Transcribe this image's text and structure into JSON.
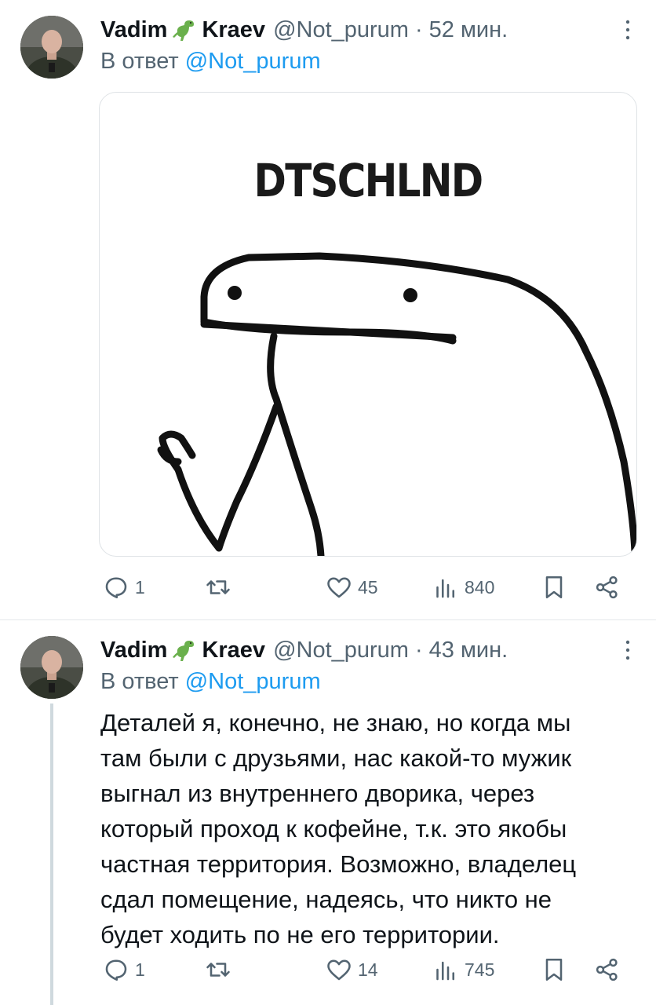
{
  "tweets": [
    {
      "author_name_first": "Vadim",
      "author_name_last": "Kraev",
      "handle": "@Not_purum",
      "separator": "·",
      "time": "52 мин.",
      "reply_prefix": "В ответ",
      "reply_to": "@Not_purum",
      "media_caption": "DTSCHLND",
      "stats": {
        "replies": "1",
        "retweets": "",
        "likes": "45",
        "views": "840"
      }
    },
    {
      "author_name_first": "Vadim",
      "author_name_last": "Kraev",
      "handle": "@Not_purum",
      "separator": "·",
      "time": "43 мин.",
      "reply_prefix": "В ответ",
      "reply_to": "@Not_purum",
      "text_lines": [
        "Деталей я, конечно, не знаю, но когда мы",
        "там были с друзьями, нас какой-то мужик",
        "выгнал из внутреннего дворика, через",
        "который проход к кофейне, т.к. это якобы",
        "частная территория. Возможно, владелец",
        "сдал помещение, надеясь, что никто не",
        "будет ходить по не его территории."
      ],
      "stats": {
        "replies": "1",
        "retweets": "",
        "likes": "14",
        "views": "745"
      }
    }
  ],
  "icons": {
    "name_badge": "dinosaur-emoji",
    "more": "vertical-dots-icon",
    "reply": "speech-bubble-icon",
    "retweet": "retweet-arrows-icon",
    "like": "heart-outline-icon",
    "views": "bar-chart-icon",
    "bookmark": "bookmark-icon",
    "share": "share-nodes-icon"
  },
  "colors": {
    "link": "#1d9bf0",
    "secondary_text": "#536471",
    "thread_line": "#cfd9de",
    "dino": "#6ab04c"
  }
}
